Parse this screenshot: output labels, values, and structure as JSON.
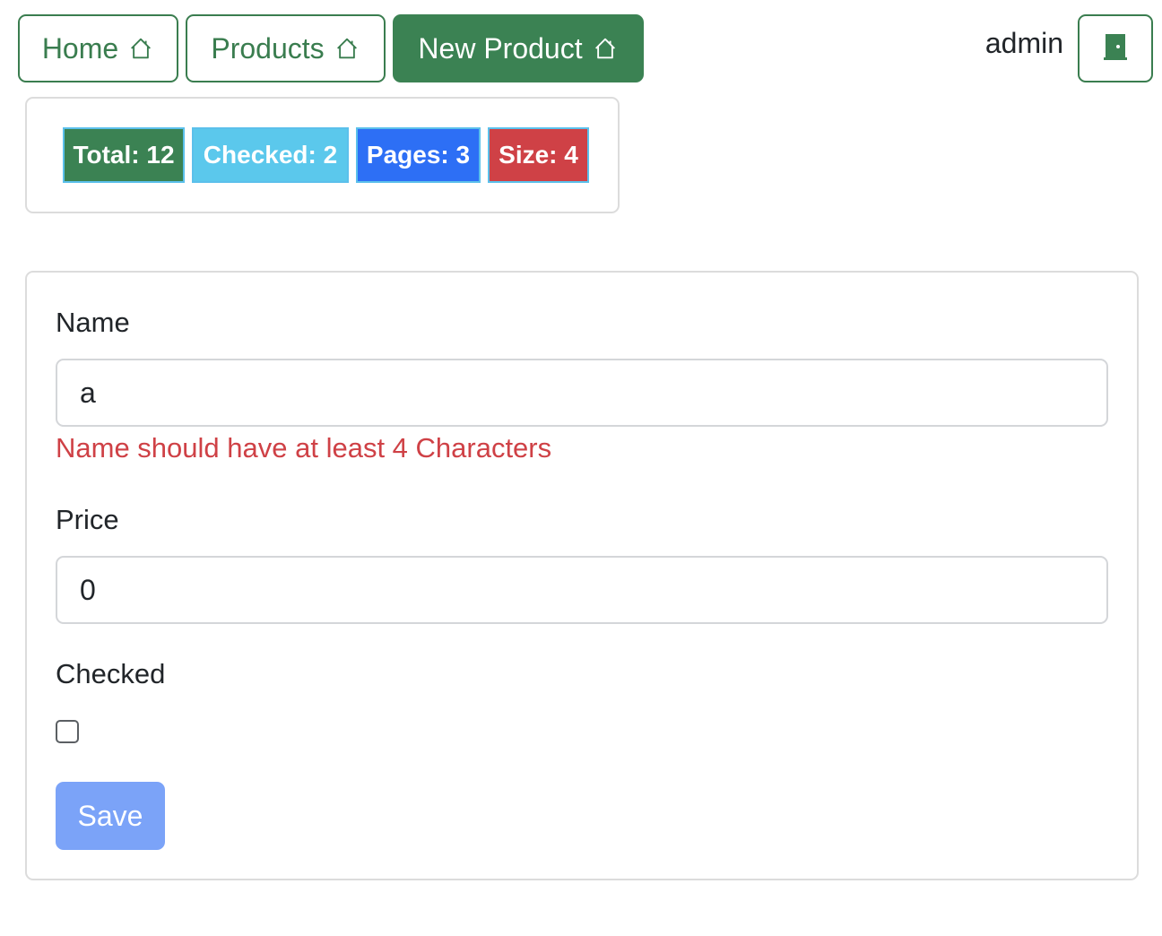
{
  "nav": {
    "home_label": "Home",
    "products_label": "Products",
    "new_product_label": "New Product",
    "icon": "house-icon",
    "accent_color": "#3b8253"
  },
  "user": {
    "name": "admin",
    "logout_icon": "door-icon"
  },
  "stats": {
    "total": "Total: 12",
    "checked": "Checked: 2",
    "pages": "Pages: 3",
    "size": "Size: 4",
    "colors": {
      "total": "#3b8253",
      "checked": "#5bc8ec",
      "pages": "#2d6ff5",
      "size": "#cf4146"
    }
  },
  "form": {
    "name_label": "Name",
    "name_value": "a",
    "name_error": "Name should have at least 4 Characters",
    "price_label": "Price",
    "price_value": "0",
    "checked_label": "Checked",
    "checked_value": false,
    "save_label": "Save",
    "error_color": "#cf4146",
    "save_color": "#7ba3f8"
  }
}
